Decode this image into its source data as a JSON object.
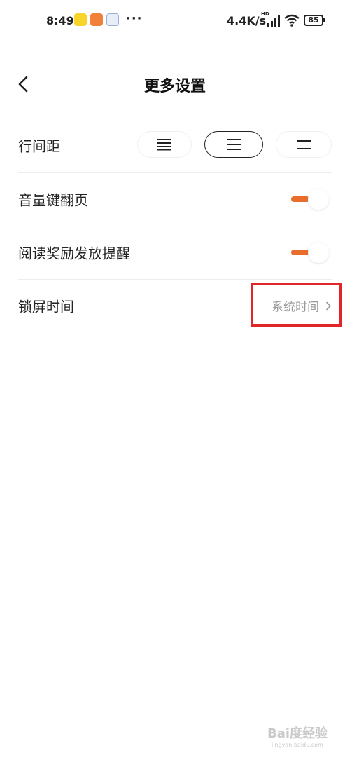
{
  "status_bar": {
    "time": "8:49",
    "app_icons": [
      "meituan-app-icon",
      "orange-app-icon",
      "blue-app-icon"
    ],
    "more": "···",
    "network_speed": "4.4K/s",
    "hd_label": "HD",
    "battery": "85"
  },
  "header": {
    "title": "更多设置",
    "back_icon": "chevron-left-icon"
  },
  "settings": {
    "line_spacing": {
      "label": "行间距",
      "options": [
        "compact-lines-icon",
        "medium-lines-icon",
        "loose-lines-icon"
      ],
      "selected_index": 1
    },
    "volume_key_page_turn": {
      "label": "音量键翻页",
      "enabled": true
    },
    "reading_reward_reminder": {
      "label": "阅读奖励发放提醒",
      "enabled": true
    },
    "lock_screen_time": {
      "label": "锁屏时间",
      "value": "系统时间"
    }
  },
  "colors": {
    "accent": "#ea6e2b",
    "highlight_box": "#e02626",
    "secondary_text": "#9a9a9a"
  },
  "watermark": {
    "text": "Bai度经验",
    "url": "jingyan.baidu.com"
  }
}
